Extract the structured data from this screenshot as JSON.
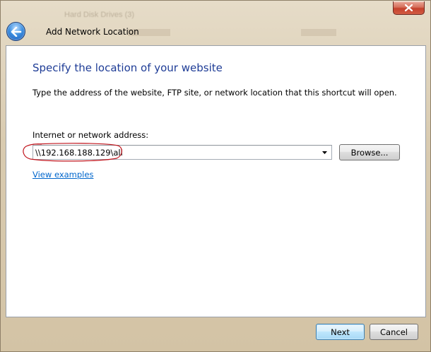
{
  "window": {
    "title": "Add Network Location",
    "background_text": "Hard Disk Drives (3)"
  },
  "icons": {
    "close": "close-x-icon",
    "back": "back-arrow-icon",
    "dropdown": "chevron-down-icon"
  },
  "content": {
    "heading": "Specify the location of your website",
    "instruction": "Type the address of the website, FTP site, or network location that this shortcut will open.",
    "address_label": "Internet or network address:",
    "address_value": "\\\\192.168.188.129\\all",
    "browse_label": "Browse...",
    "examples_link": "View examples"
  },
  "footer": {
    "next_label": "Next",
    "cancel_label": "Cancel"
  },
  "colors": {
    "heading": "#1e3c96",
    "link": "#0066cc",
    "annotation": "#c0141c"
  }
}
